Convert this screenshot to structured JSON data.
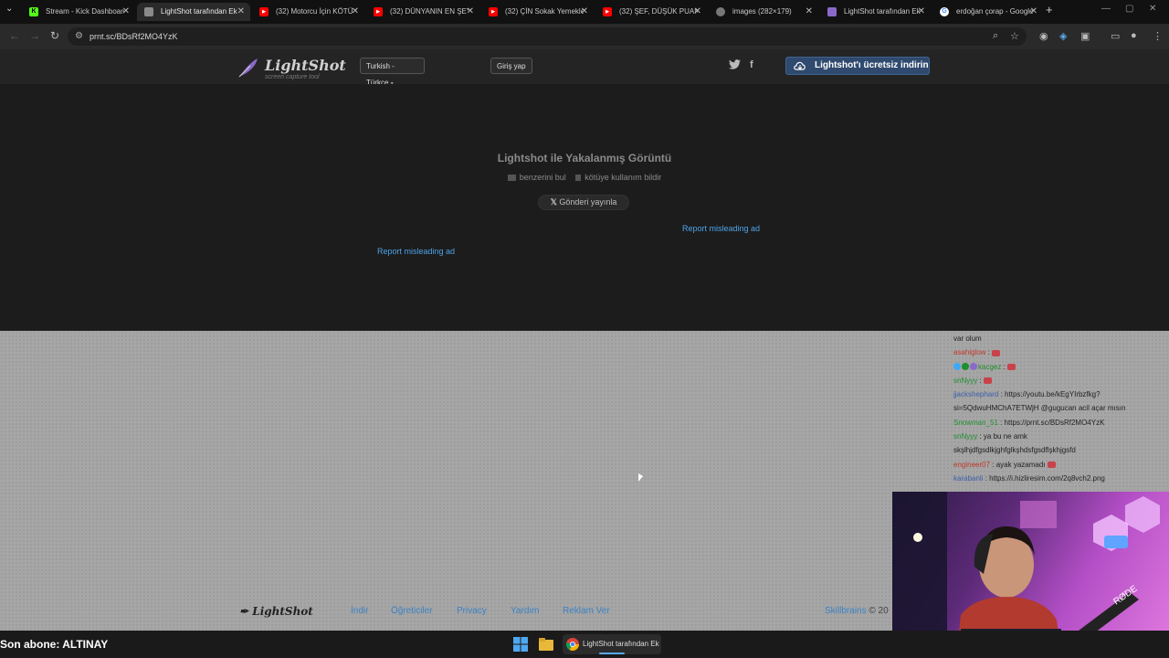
{
  "browser": {
    "tabs": [
      {
        "title": "Stream - Kick Dashboard",
        "icon": "kick-icon",
        "color": "#53fc18",
        "active": false
      },
      {
        "title": "LightShot tarafından Ek",
        "icon": "lightshot-icon",
        "color": "#8a8a8a",
        "active": true
      },
      {
        "title": "(32) Motorcu İçin KÖTÜ",
        "icon": "youtube-icon",
        "color": "#ff0000",
        "active": false
      },
      {
        "title": "(32) DÜNYANIN EN ŞEY",
        "icon": "youtube-icon",
        "color": "#ff0000",
        "active": false
      },
      {
        "title": "(32) ÇİN Sokak Yemekle",
        "icon": "youtube-icon",
        "color": "#ff0000",
        "active": false
      },
      {
        "title": "(32) ŞEF, DÜŞÜK PUAN",
        "icon": "youtube-icon",
        "color": "#ff0000",
        "active": false
      },
      {
        "title": "images (282×179)",
        "icon": "globe-icon",
        "color": "#777777",
        "active": false
      },
      {
        "title": "LightShot tarafından Ek",
        "icon": "lightshot-icon",
        "color": "#8a6ac9",
        "active": false
      },
      {
        "title": "erdoğan çorap - Google",
        "icon": "google-icon",
        "color": "#4285f4",
        "active": false
      }
    ],
    "url": "prnt.sc/BDsRf2MO4YzK"
  },
  "lightshot": {
    "logo": "LightShot",
    "logo_sub": "screen capture tool",
    "language": "Turkish - Türkçe",
    "login": "Giriş yap",
    "download_button": "Lightshot'ı ücretsiz indirin",
    "title": "Lightshot ile Yakalanmış Görüntü",
    "find_similar": "benzerini bul",
    "report_abuse": "kötüye kullanım bildir",
    "post_button": "Gönderi yayınla",
    "report_ad_1": "Report misleading ad",
    "report_ad_2": "Report misleading ad",
    "footer": {
      "logo": "LightShot",
      "links": [
        "İndir",
        "Öğreticiler",
        "Privacy",
        "Yardım",
        "Reklam Ver"
      ],
      "company": "Skillbrains",
      "copyright": "© 20"
    }
  },
  "chat": {
    "messages": [
      {
        "user": "",
        "text": "",
        "color": "#c0392b",
        "emote": false,
        "partial": true
      },
      {
        "user": "",
        "text": "var olum",
        "color": "#222222",
        "emote": false
      },
      {
        "user": "asahiglow",
        "text": "",
        "color": "#c0392b",
        "emote": true
      },
      {
        "user": "kacgez",
        "text": "",
        "color": "#1e8f2e",
        "emote": true
      },
      {
        "user": "snNyyy",
        "text": "",
        "color": "#1e8f2e",
        "emote": true
      },
      {
        "user": "jjackshephard",
        "text": "https://youtu.be/kEgYIrbzfkg?",
        "color": "#3b5fa8",
        "emote": false
      },
      {
        "user": "",
        "text": "si=5QdwuHMChA7ETWjH @gugucan acil açar mısın",
        "color": "#222222",
        "emote": false
      },
      {
        "user": "Snowman_51",
        "text": "https://prnt.sc/BDsRf2MO4YzK",
        "color": "#1e8f2e",
        "emote": false
      },
      {
        "user": "snNyyy",
        "text": "ya bu ne amk",
        "color": "#1e8f2e",
        "emote": false
      },
      {
        "user": "",
        "text": "skşlhjdfgsdlkjghfglkşhdsfgsdflşkhjgsfd",
        "color": "#222222",
        "emote": false
      },
      {
        "user": "engineer07",
        "text": "ayak yazamadı",
        "color": "#c0392b",
        "emote": true
      },
      {
        "user": "karabanli",
        "text": "https://i.hizliresim.com/2q8vch2.png",
        "color": "#3b5fa8",
        "emote": false
      }
    ]
  },
  "stream": {
    "last_subscriber": "Son abone: ALTINAY"
  },
  "taskbar": {
    "active_app": "LightShot tarafından Ek"
  }
}
